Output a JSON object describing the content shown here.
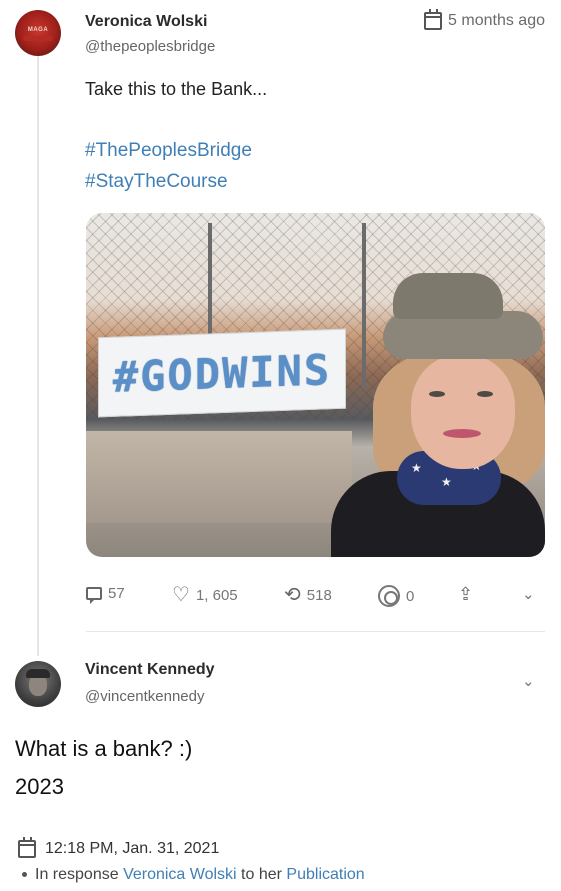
{
  "post": {
    "author_name": "Veronica Wolski",
    "author_handle": "@thepeoplesbridge",
    "time_ago": "5 months ago",
    "text": "Take this to the Bank...",
    "hashtags": [
      "#ThePeoplesBridge",
      "#StayTheCourse"
    ],
    "image": {
      "banner_text": "#GODWINS",
      "description_icon": "selfie-photo"
    },
    "actions": {
      "replies": "57",
      "likes": "1, 605",
      "reposts": "518",
      "tips": "0"
    }
  },
  "reply": {
    "author_name": "Vincent Kennedy",
    "author_handle": "@vincentkennedy",
    "text_line1": "What is a bank? :)",
    "text_line2": "2023",
    "timestamp": "12:18 PM, Jan. 31, 2021",
    "response_prefix": "In response",
    "response_user": "Veronica Wolski",
    "response_middle": "to her",
    "response_link": "Publication"
  },
  "colors": {
    "link": "#3f7fb6",
    "text": "#1a1a1a",
    "muted": "#6b6b6b"
  },
  "icons": [
    "calendar-icon",
    "reply-icon",
    "heart-icon",
    "repost-icon",
    "tip-icon",
    "share-icon",
    "chevron-down-icon"
  ]
}
